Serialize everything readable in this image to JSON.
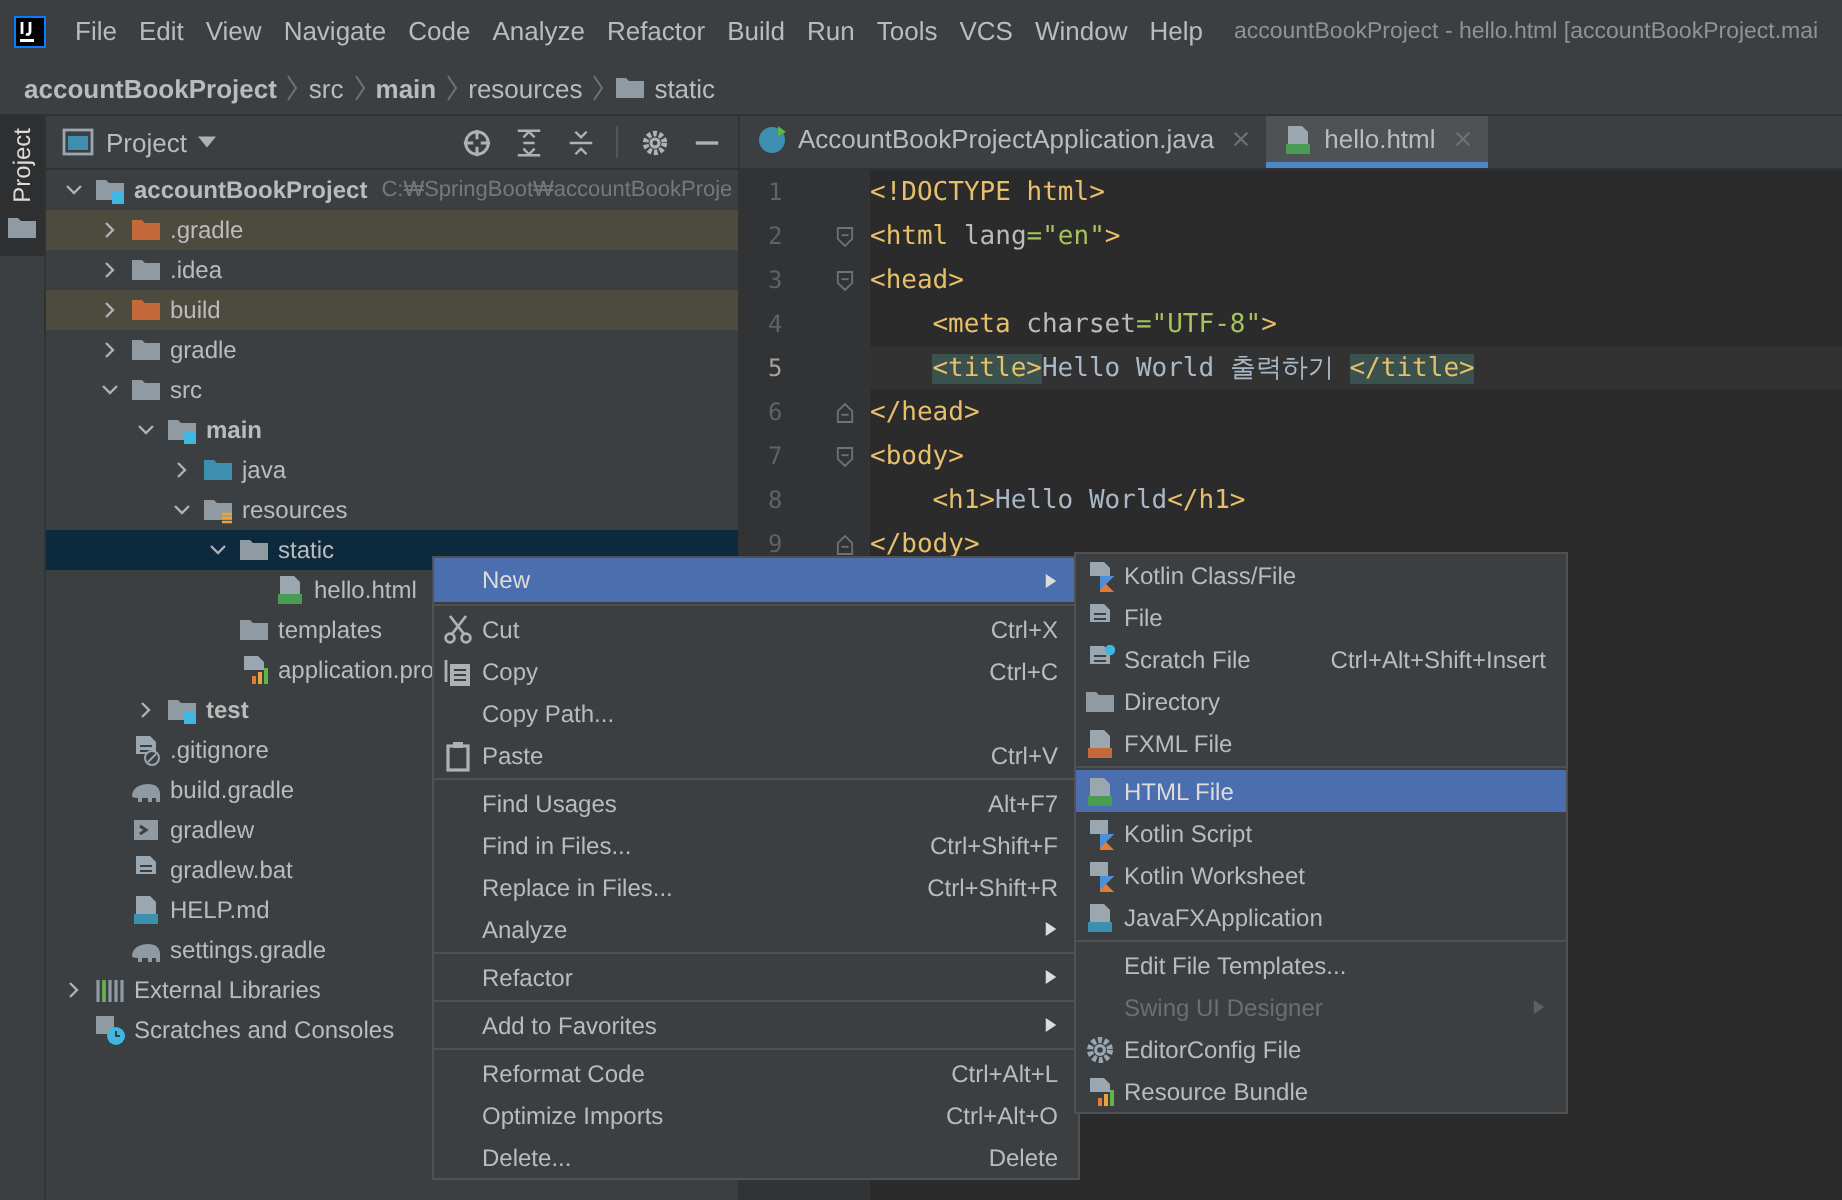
{
  "menu_bar": {
    "items": [
      "File",
      "Edit",
      "View",
      "Navigate",
      "Code",
      "Analyze",
      "Refactor",
      "Build",
      "Run",
      "Tools",
      "VCS",
      "Window",
      "Help"
    ],
    "title": "accountBookProject - hello.html [accountBookProject.mai"
  },
  "breadcrumb": [
    {
      "label": "accountBookProject",
      "bold": true
    },
    {
      "label": "src",
      "bold": false
    },
    {
      "label": "main",
      "bold": true
    },
    {
      "label": "resources",
      "bold": false
    },
    {
      "label": "static",
      "bold": false
    }
  ],
  "side_stripe": {
    "tab": "Project",
    "selected": true
  },
  "project_panel": {
    "title": "Project",
    "tree": [
      {
        "label": "accountBookProject",
        "kind": "module",
        "bold": true,
        "path": "C:₩SpringBoot₩accountBookProje",
        "expanded": true,
        "selected": false,
        "excluded": false,
        "children": [
          {
            "label": ".gradle",
            "kind": "folder",
            "bold": false,
            "expanded": false,
            "selected": false,
            "excluded": true
          },
          {
            "label": ".idea",
            "kind": "folder",
            "bold": false,
            "expanded": false,
            "selected": false,
            "excluded": false
          },
          {
            "label": "build",
            "kind": "folder",
            "bold": false,
            "expanded": false,
            "selected": false,
            "excluded": true
          },
          {
            "label": "gradle",
            "kind": "folder",
            "bold": false,
            "expanded": false,
            "selected": false,
            "excluded": false
          },
          {
            "label": "src",
            "kind": "folder",
            "bold": false,
            "expanded": true,
            "selected": false,
            "excluded": false,
            "children": [
              {
                "label": "main",
                "kind": "module",
                "bold": true,
                "expanded": true,
                "selected": false,
                "excluded": false,
                "children": [
                  {
                    "label": "java",
                    "kind": "sources",
                    "bold": false,
                    "expanded": false,
                    "selected": false,
                    "excluded": false
                  },
                  {
                    "label": "resources",
                    "kind": "resources",
                    "bold": false,
                    "expanded": true,
                    "selected": false,
                    "excluded": false,
                    "children": [
                      {
                        "label": "static",
                        "kind": "folder",
                        "bold": false,
                        "expanded": true,
                        "selected": true,
                        "excluded": false,
                        "children": [
                          {
                            "label": "hello.html",
                            "kind": "html",
                            "bold": false,
                            "selected": false,
                            "excluded": false
                          }
                        ]
                      },
                      {
                        "label": "templates",
                        "kind": "folder",
                        "bold": false,
                        "selected": false,
                        "excluded": false
                      },
                      {
                        "label": "application.pro",
                        "kind": "properties",
                        "bold": false,
                        "selected": false,
                        "excluded": false
                      }
                    ]
                  }
                ]
              },
              {
                "label": "test",
                "kind": "module",
                "bold": true,
                "expanded": false,
                "selected": false,
                "excluded": false
              }
            ]
          },
          {
            "label": ".gitignore",
            "kind": "ignore",
            "bold": false,
            "selected": false,
            "excluded": false
          },
          {
            "label": "build.gradle",
            "kind": "gradle",
            "bold": false,
            "selected": false,
            "excluded": false
          },
          {
            "label": "gradlew",
            "kind": "shell",
            "bold": false,
            "selected": false,
            "excluded": false
          },
          {
            "label": "gradlew.bat",
            "kind": "text",
            "bold": false,
            "selected": false,
            "excluded": false
          },
          {
            "label": "HELP.md",
            "kind": "markdown",
            "bold": false,
            "selected": false,
            "excluded": false
          },
          {
            "label": "settings.gradle",
            "kind": "gradle",
            "bold": false,
            "selected": false,
            "excluded": false
          }
        ]
      },
      {
        "label": "External Libraries",
        "kind": "libraries",
        "bold": false,
        "expanded": false,
        "selected": false,
        "excluded": false
      },
      {
        "label": "Scratches and Consoles",
        "kind": "scratches",
        "bold": false,
        "selected": false,
        "excluded": false
      }
    ]
  },
  "editor": {
    "tabs": [
      {
        "label": "AccountBookProjectApplication.java",
        "kind": "java",
        "selected": false
      },
      {
        "label": "hello.html",
        "kind": "html",
        "selected": true
      }
    ],
    "lines": [
      {
        "number": "1",
        "kind": "plain",
        "current": false,
        "indented": false,
        "tokens": [
          {
            "kind": "tag",
            "text": "<!DOCTYPE html>"
          }
        ]
      },
      {
        "number": "2",
        "kind": "fold-start",
        "current": false,
        "indented": false,
        "tokens": [
          {
            "kind": "tag",
            "text": "<html "
          },
          {
            "kind": "attr",
            "text": "lang"
          },
          {
            "kind": "string",
            "text": "=\"en\""
          },
          {
            "kind": "tag",
            "text": ">"
          }
        ]
      },
      {
        "number": "3",
        "kind": "fold-start",
        "current": false,
        "indented": false,
        "tokens": [
          {
            "kind": "tag",
            "text": "<head>"
          }
        ]
      },
      {
        "number": "4",
        "kind": "plain",
        "current": false,
        "indented": true,
        "tokens": [
          {
            "kind": "tag",
            "text": "<meta "
          },
          {
            "kind": "attr",
            "text": "charset"
          },
          {
            "kind": "string",
            "text": "=\"UTF-8\""
          },
          {
            "kind": "tag",
            "text": ">"
          }
        ]
      },
      {
        "number": "5",
        "kind": "plain",
        "current": true,
        "indented": true,
        "tokens": [
          {
            "kind": "match",
            "text": "<title>"
          },
          {
            "kind": "text",
            "text": "Hello World 출력하기 "
          },
          {
            "kind": "match",
            "text": "</title>"
          }
        ]
      },
      {
        "number": "6",
        "kind": "fold-end",
        "current": false,
        "indented": false,
        "tokens": [
          {
            "kind": "tag",
            "text": "</head>"
          }
        ]
      },
      {
        "number": "7",
        "kind": "fold-start",
        "current": false,
        "indented": false,
        "tokens": [
          {
            "kind": "tag",
            "text": "<body>"
          }
        ]
      },
      {
        "number": "8",
        "kind": "plain",
        "current": false,
        "indented": true,
        "tokens": [
          {
            "kind": "tag",
            "text": "<h1>"
          },
          {
            "kind": "text",
            "text": "Hello World"
          },
          {
            "kind": "tag",
            "text": "</h1>"
          }
        ]
      },
      {
        "number": "9",
        "kind": "fold-end",
        "current": false,
        "indented": false,
        "tokens": [
          {
            "kind": "tag",
            "text": "</body>"
          }
        ]
      }
    ]
  },
  "context_menu": {
    "items": [
      {
        "kind": "plain",
        "label": "New",
        "submenu": true,
        "selected": true
      },
      {
        "kind": "separator"
      },
      {
        "kind": "cut",
        "label": "Cut",
        "shortcut": "Ctrl+X",
        "submenu": false,
        "selected": false
      },
      {
        "kind": "copy",
        "label": "Copy",
        "shortcut": "Ctrl+C",
        "submenu": false,
        "selected": false
      },
      {
        "kind": "plain",
        "label": "Copy Path...",
        "submenu": false,
        "selected": false
      },
      {
        "kind": "paste",
        "label": "Paste",
        "shortcut": "Ctrl+V",
        "submenu": false,
        "selected": false
      },
      {
        "kind": "separator"
      },
      {
        "kind": "plain",
        "label": "Find Usages",
        "shortcut": "Alt+F7",
        "submenu": false,
        "selected": false
      },
      {
        "kind": "plain",
        "label": "Find in Files...",
        "shortcut": "Ctrl+Shift+F",
        "submenu": false,
        "selected": false
      },
      {
        "kind": "plain",
        "label": "Replace in Files...",
        "shortcut": "Ctrl+Shift+R",
        "submenu": false,
        "selected": false
      },
      {
        "kind": "plain",
        "label": "Analyze",
        "submenu": true,
        "selected": false
      },
      {
        "kind": "separator"
      },
      {
        "kind": "plain",
        "label": "Refactor",
        "submenu": true,
        "selected": false
      },
      {
        "kind": "separator"
      },
      {
        "kind": "plain",
        "label": "Add to Favorites",
        "submenu": true,
        "selected": false
      },
      {
        "kind": "separator"
      },
      {
        "kind": "plain",
        "label": "Reformat Code",
        "shortcut": "Ctrl+Alt+L",
        "submenu": false,
        "selected": false
      },
      {
        "kind": "plain",
        "label": "Optimize Imports",
        "shortcut": "Ctrl+Alt+O",
        "submenu": false,
        "selected": false
      },
      {
        "kind": "plain",
        "label": "Delete...",
        "shortcut": "Delete",
        "submenu": false,
        "selected": false
      }
    ]
  },
  "submenu": {
    "items": [
      {
        "kind": "kotlin",
        "label": "Kotlin Class/File",
        "submenu": false,
        "selected": false,
        "disabled": false
      },
      {
        "kind": "file",
        "label": "File",
        "submenu": false,
        "selected": false,
        "disabled": false
      },
      {
        "kind": "scratch",
        "label": "Scratch File",
        "shortcut": "Ctrl+Alt+Shift+Insert",
        "submenu": false,
        "selected": false,
        "disabled": false
      },
      {
        "kind": "folder",
        "label": "Directory",
        "submenu": false,
        "selected": false,
        "disabled": false
      },
      {
        "kind": "fxml",
        "label": "FXML File",
        "submenu": false,
        "selected": false,
        "disabled": false
      },
      {
        "kind": "separator"
      },
      {
        "kind": "html",
        "label": "HTML File",
        "submenu": false,
        "selected": true,
        "disabled": false
      },
      {
        "kind": "kotlin-script",
        "label": "Kotlin Script",
        "submenu": false,
        "selected": false,
        "disabled": false
      },
      {
        "kind": "kotlin-script",
        "label": "Kotlin Worksheet",
        "submenu": false,
        "selected": false,
        "disabled": false
      },
      {
        "kind": "javafx",
        "label": "JavaFXApplication",
        "submenu": false,
        "selected": false,
        "disabled": false
      },
      {
        "kind": "separator"
      },
      {
        "kind": "plain",
        "label": "Edit File Templates...",
        "submenu": false,
        "selected": false,
        "disabled": false
      },
      {
        "kind": "plain",
        "label": "Swing UI Designer",
        "submenu": true,
        "selected": false,
        "disabled": true
      },
      {
        "kind": "gear",
        "label": "EditorConfig File",
        "submenu": false,
        "selected": false,
        "disabled": false
      },
      {
        "kind": "properties",
        "label": "Resource Bundle",
        "submenu": false,
        "selected": false,
        "disabled": false
      }
    ]
  }
}
